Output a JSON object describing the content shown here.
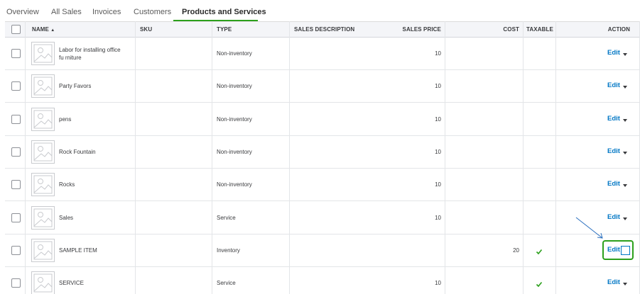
{
  "tabs": [
    {
      "label": "Overview"
    },
    {
      "label": "All Sales"
    },
    {
      "label": "Invoices"
    },
    {
      "label": "Customers"
    },
    {
      "label": "Products and Services",
      "active": true
    }
  ],
  "columns": {
    "name": "NAME",
    "sku": "SKU",
    "type": "TYPE",
    "sales_description": "SALES DESCRIPTION",
    "sales_price": "SALES PRICE",
    "cost": "COST",
    "taxable": "TAXABLE",
    "action": "ACTION"
  },
  "sort_indicator": "▲",
  "rows": [
    {
      "name": "Labor for installing office fu rniture",
      "sku": "",
      "type": "Non-inventory",
      "sales_description": "",
      "sales_price": "10",
      "cost": "",
      "taxable": false,
      "action": "Edit"
    },
    {
      "name": "Party Favors",
      "sku": "",
      "type": "Non-inventory",
      "sales_description": "",
      "sales_price": "10",
      "cost": "",
      "taxable": false,
      "action": "Edit"
    },
    {
      "name": "pens",
      "sku": "",
      "type": "Non-inventory",
      "sales_description": "",
      "sales_price": "10",
      "cost": "",
      "taxable": false,
      "action": "Edit"
    },
    {
      "name": "Rock Fountain",
      "sku": "",
      "type": "Non-inventory",
      "sales_description": "",
      "sales_price": "10",
      "cost": "",
      "taxable": false,
      "action": "Edit"
    },
    {
      "name": "Rocks",
      "sku": "",
      "type": "Non-inventory",
      "sales_description": "",
      "sales_price": "10",
      "cost": "",
      "taxable": false,
      "action": "Edit"
    },
    {
      "name": "Sales",
      "sku": "",
      "type": "Service",
      "sales_description": "",
      "sales_price": "10",
      "cost": "",
      "taxable": false,
      "action": "Edit"
    },
    {
      "name": "SAMPLE ITEM",
      "sku": "",
      "type": "Inventory",
      "sales_description": "",
      "sales_price": "",
      "cost": "20",
      "taxable": true,
      "action": "Edit"
    },
    {
      "name": "SERVICE",
      "sku": "",
      "type": "Service",
      "sales_description": "",
      "sales_price": "10",
      "cost": "",
      "taxable": true,
      "action": "Edit"
    }
  ],
  "colors": {
    "accent_green": "#2ca01c",
    "link_blue": "#0077c5",
    "annotation_arrow": "#2a6fbf"
  },
  "icons": {
    "thumbnail": "image-placeholder-icon",
    "taxable": "checkmark-icon",
    "action_menu": "caret-down-icon",
    "sort": "sort-ascending-icon",
    "annotation": "annotation-arrow-icon"
  }
}
